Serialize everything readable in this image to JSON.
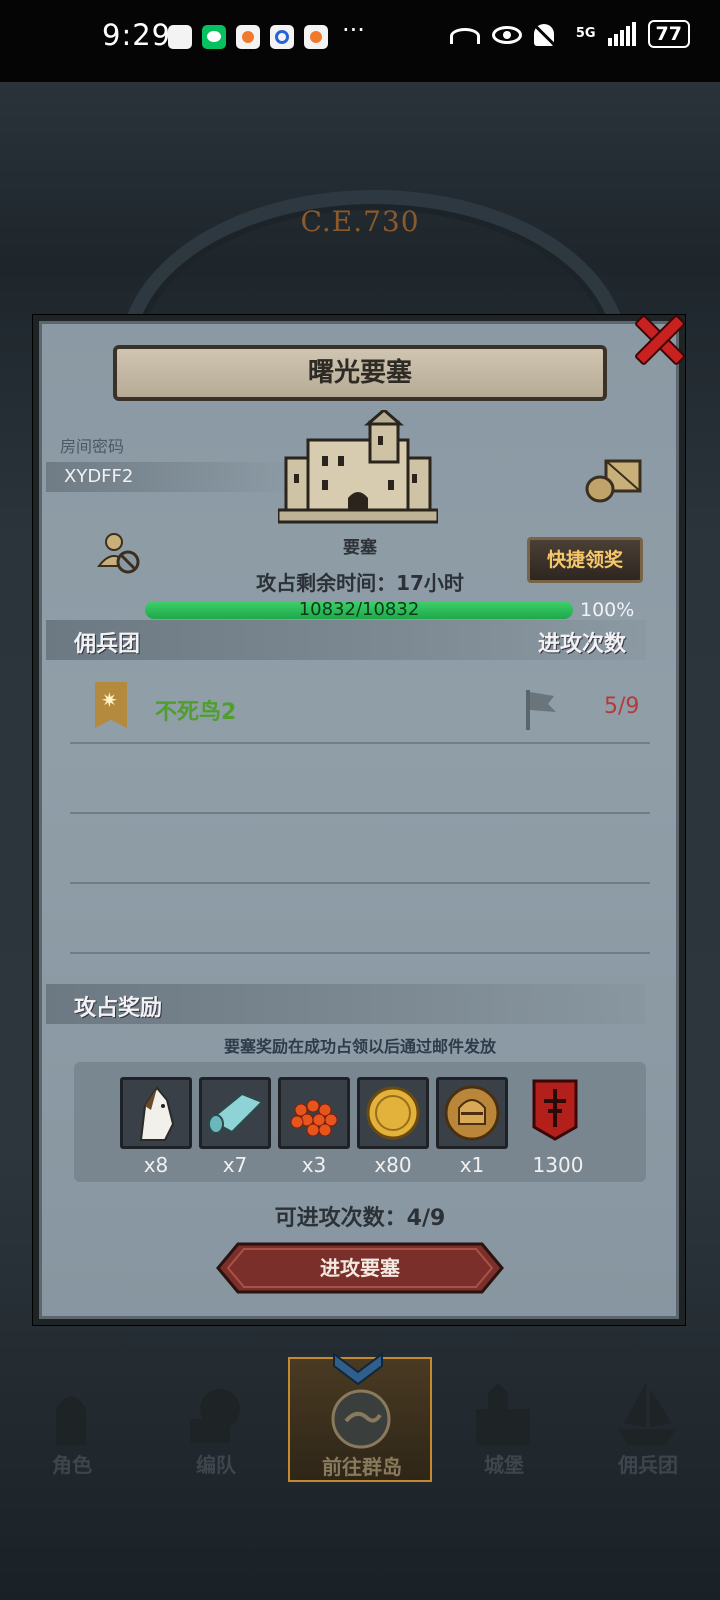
{
  "status_bar": {
    "time": "9:29",
    "more": "···",
    "network": "5G",
    "battery": "77"
  },
  "background": {
    "era": "C.E.730"
  },
  "dialog": {
    "title": "曙光要塞",
    "room_label": "房间密码",
    "room_code": "XYDFF2",
    "building_label": "要塞",
    "quick_claim": "快捷领奖",
    "time_left": "攻占剩余时间：17小时",
    "hp": {
      "current": 10832,
      "max": 10832,
      "text": "10832/10832",
      "percent_text": "100%"
    },
    "mercenary_header": "佣兵团",
    "attack_count_header": "进攻次数",
    "guilds": [
      {
        "name": "不死鸟2",
        "attacks": "5/9",
        "name_color": "#4f9e2f",
        "count_color": "#b53a3a"
      }
    ],
    "reward_header": "攻占奖励",
    "reward_note": "要塞奖励在成功占领以后通过邮件发放",
    "rewards": [
      {
        "icon": "horse-icon",
        "count": "x8"
      },
      {
        "icon": "cloth-icon",
        "count": "x7"
      },
      {
        "icon": "roe-icon",
        "count": "x3"
      },
      {
        "icon": "gold-coin-icon",
        "count": "x80"
      },
      {
        "icon": "knight-helmet-coin-icon",
        "count": "x1"
      },
      {
        "icon": "red-banner-icon",
        "count": "1300"
      }
    ],
    "remaining_attacks": "可进攻次数：4/9",
    "attack_button": "进攻要塞"
  },
  "nav": {
    "items": [
      {
        "label": "角色",
        "icon": "knight-icon",
        "active": false
      },
      {
        "label": "编队",
        "icon": "formation-icon",
        "active": false
      },
      {
        "label": "前往群岛",
        "icon": "islands-icon",
        "active": true
      },
      {
        "label": "城堡",
        "icon": "castle-icon",
        "active": false
      },
      {
        "label": "佣兵团",
        "icon": "ship-icon",
        "active": false
      }
    ]
  },
  "colors": {
    "panel": "#8b99a4",
    "hp_green": "#2fbf5a",
    "accent_gold": "#f5c76a",
    "close_red": "#c92020",
    "attack_button": "#7a2f2a"
  }
}
